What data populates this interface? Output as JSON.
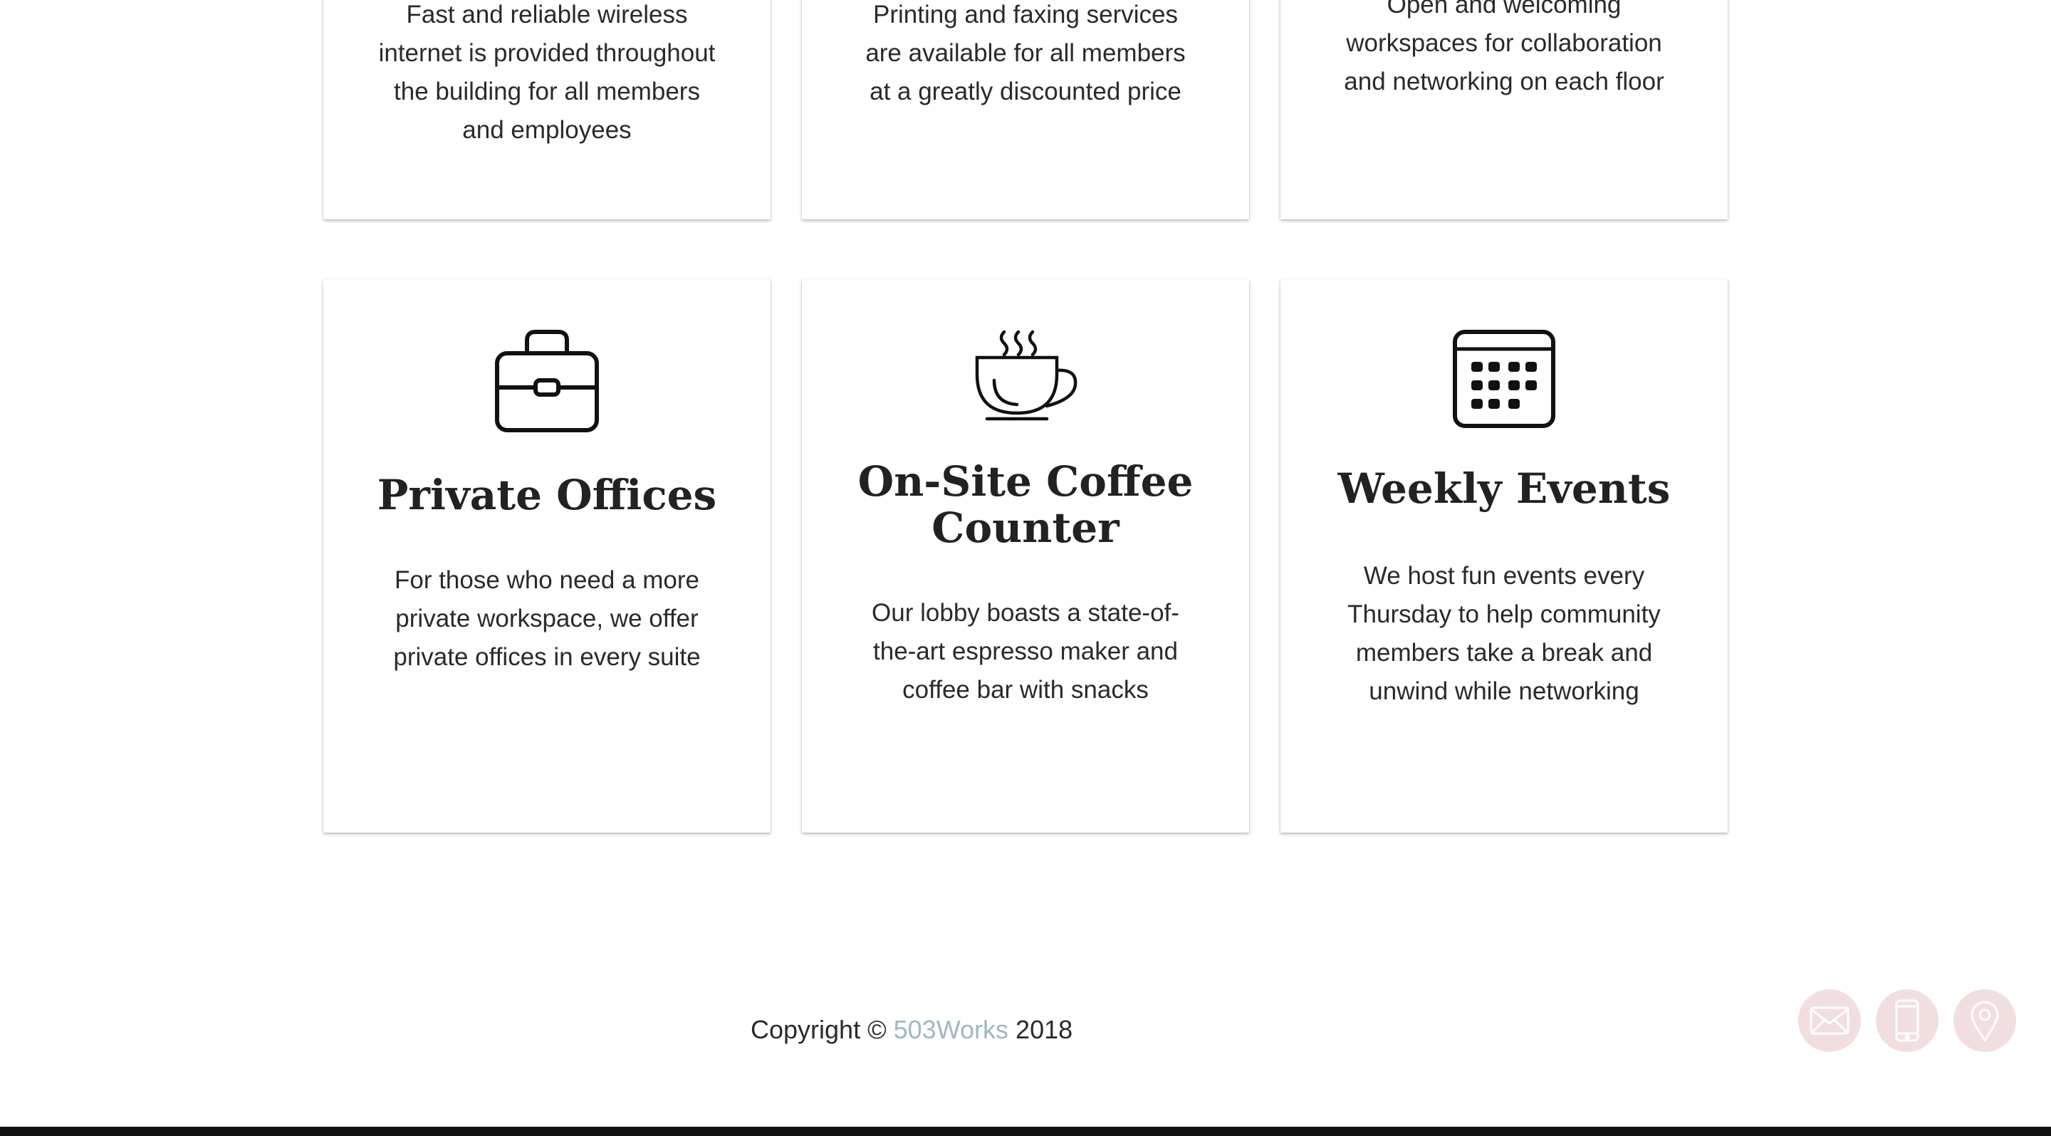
{
  "features_row1": [
    {
      "description": "Fast and reliable wireless internet is provided throughout the building for all members and employees"
    },
    {
      "description": "Printing and faxing services are available for all members at a greatly discounted price"
    },
    {
      "description": "Open and welcoming workspaces for collaboration and networking on each floor"
    }
  ],
  "features_row2": [
    {
      "icon": "briefcase-icon",
      "title": "Private Offices",
      "description": "For those who need a more private workspace, we offer private offices in every suite"
    },
    {
      "icon": "coffee-cup-icon",
      "title": "On-Site Coffee Counter",
      "description": "Our lobby boasts a state-of-the-art espresso maker and coffee bar with snacks"
    },
    {
      "icon": "calendar-icon",
      "title": "Weekly Events",
      "description": "We host fun events every Thursday to help community members take a break and unwind while networking"
    }
  ],
  "footer": {
    "prefix": "Copyright ©",
    "brand": "503Works",
    "year": "2018"
  },
  "contact_buttons": [
    {
      "icon": "mail-icon"
    },
    {
      "icon": "phone-icon"
    },
    {
      "icon": "location-pin-icon"
    }
  ],
  "colors": {
    "brand_link": "#9fb8c0",
    "fab_background": "#f1dfdf",
    "fab_icon": "#ffffff"
  }
}
